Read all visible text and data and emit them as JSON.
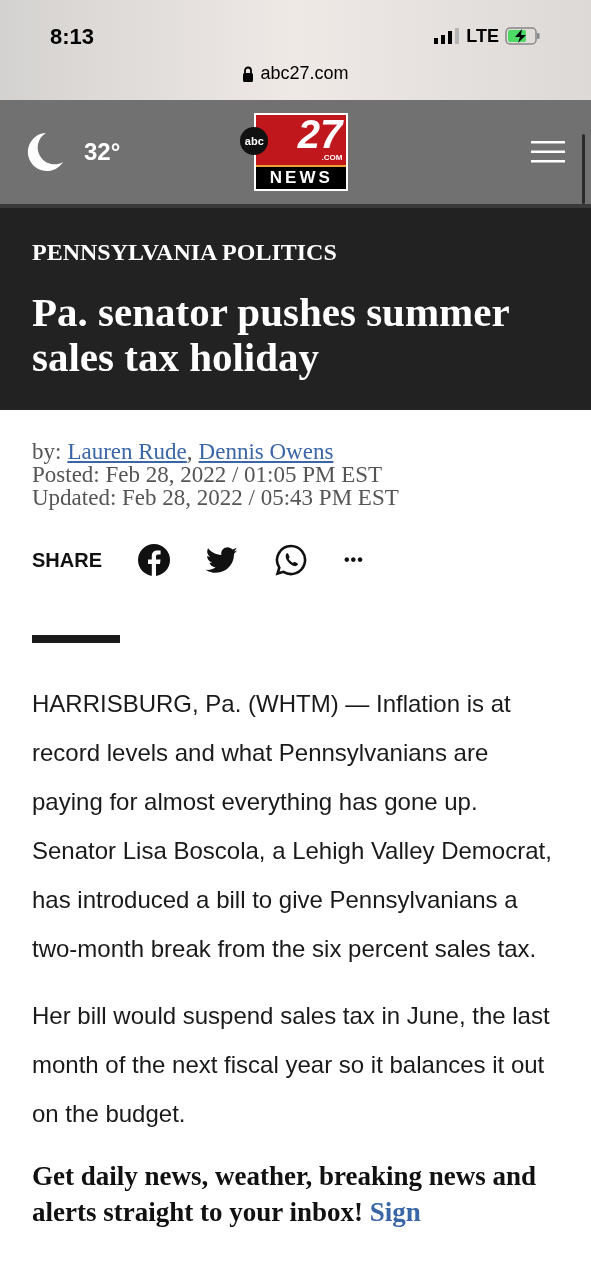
{
  "status_bar": {
    "time": "8:13",
    "network": "LTE"
  },
  "address_bar": {
    "url": "abc27.com"
  },
  "site_header": {
    "temperature": "32°",
    "logo": {
      "network": "abc",
      "channel": "27",
      "domain": ".COM",
      "label": "NEWS"
    }
  },
  "article": {
    "category": "PENNSYLVANIA POLITICS",
    "headline": "Pa. senator pushes summer sales tax holiday",
    "byline": {
      "prefix": "by:",
      "authors": [
        "Lauren Rude",
        "Dennis Owens"
      ],
      "separator": ","
    },
    "posted": "Posted: Feb 28, 2022 / 01:05 PM EST",
    "updated": "Updated: Feb 28, 2022 / 05:43 PM EST",
    "share": {
      "label": "SHARE",
      "more": "•••"
    },
    "paragraphs": [
      "HARRISBURG, Pa. (WHTM) — Inflation is at record levels and what Pennsylvanians are paying for almost everything has gone up. Senator Lisa Boscola, a Lehigh Valley Democrat, has introduced a bill to give Pennsylvanians a two-month break from the six percent sales tax.",
      "Her bill would suspend sales tax in June, the last month of the next fiscal year so it balances it out on the budget."
    ],
    "newsletter": {
      "text": "Get daily news, weather, breaking news and alerts straight to your inbox!",
      "link": "Sign"
    }
  }
}
